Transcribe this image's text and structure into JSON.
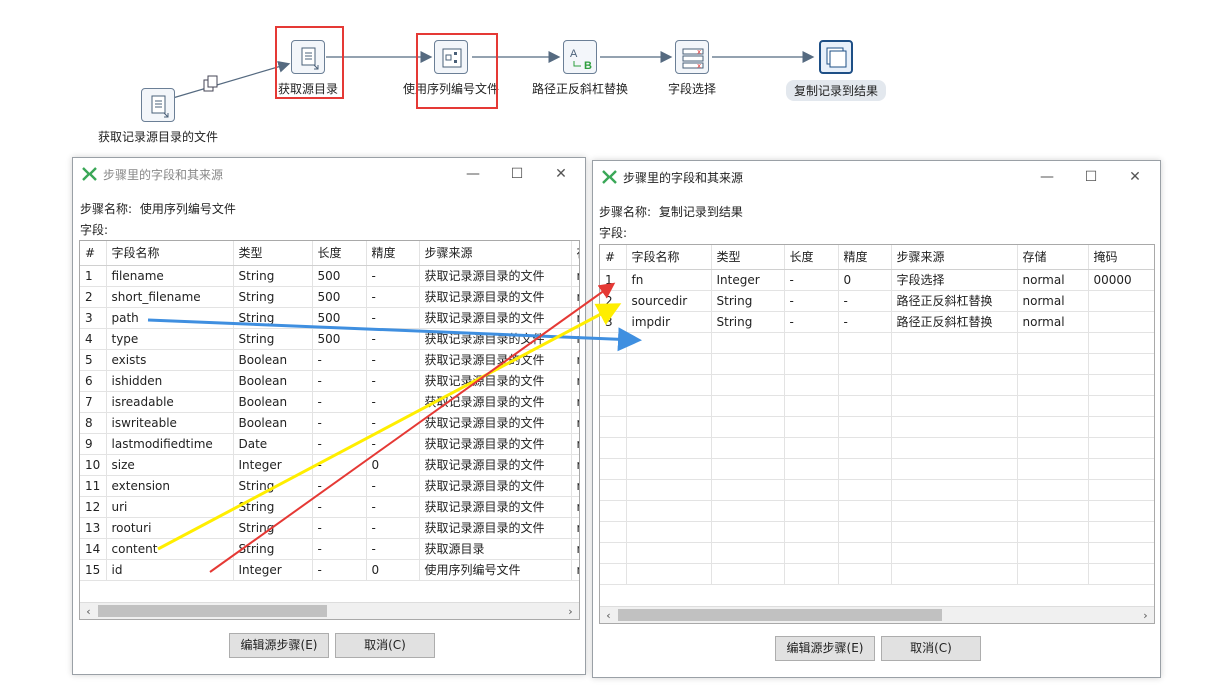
{
  "canvas": {
    "steps": [
      {
        "label": "获取记录源目录的文件"
      },
      {
        "label": "获取源目录"
      },
      {
        "label": "使用序列编号文件"
      },
      {
        "label": "路径正反斜杠替换"
      },
      {
        "label": "字段选择"
      },
      {
        "label": "复制记录到结果"
      }
    ]
  },
  "dialog_left": {
    "title": "步骤里的字段和其来源",
    "step_name_label": "步骤名称:",
    "step_name_value": "使用序列编号文件",
    "fields_label": "字段:",
    "columns": [
      "#",
      "字段名称",
      "类型",
      "长度",
      "精度",
      "步骤来源",
      "存"
    ],
    "rows": [
      [
        "1",
        "filename",
        "String",
        "500",
        "-",
        "获取记录源目录的文件",
        "n"
      ],
      [
        "2",
        "short_filename",
        "String",
        "500",
        "-",
        "获取记录源目录的文件",
        "n"
      ],
      [
        "3",
        "path",
        "String",
        "500",
        "-",
        "获取记录源目录的文件",
        "n"
      ],
      [
        "4",
        "type",
        "String",
        "500",
        "-",
        "获取记录源目录的文件",
        "n"
      ],
      [
        "5",
        "exists",
        "Boolean",
        "-",
        "-",
        "获取记录源目录的文件",
        "n"
      ],
      [
        "6",
        "ishidden",
        "Boolean",
        "-",
        "-",
        "获取记录源目录的文件",
        "n"
      ],
      [
        "7",
        "isreadable",
        "Boolean",
        "-",
        "-",
        "获取记录源目录的文件",
        "n"
      ],
      [
        "8",
        "iswriteable",
        "Boolean",
        "-",
        "-",
        "获取记录源目录的文件",
        "n"
      ],
      [
        "9",
        "lastmodifiedtime",
        "Date",
        "-",
        "-",
        "获取记录源目录的文件",
        "n"
      ],
      [
        "10",
        "size",
        "Integer",
        "-",
        "0",
        "获取记录源目录的文件",
        "n"
      ],
      [
        "11",
        "extension",
        "String",
        "-",
        "-",
        "获取记录源目录的文件",
        "n"
      ],
      [
        "12",
        "uri",
        "String",
        "-",
        "-",
        "获取记录源目录的文件",
        "n"
      ],
      [
        "13",
        "rooturi",
        "String",
        "-",
        "-",
        "获取记录源目录的文件",
        "n"
      ],
      [
        "14",
        "content",
        "String",
        "-",
        "-",
        "获取源目录",
        "n"
      ],
      [
        "15",
        "id",
        "Integer",
        "-",
        "0",
        "使用序列编号文件",
        "n"
      ]
    ],
    "edit_button": "编辑源步骤(E)",
    "cancel_button": "取消(C)"
  },
  "dialog_right": {
    "title": "步骤里的字段和其来源",
    "step_name_label": "步骤名称:",
    "step_name_value": "复制记录到结果",
    "fields_label": "字段:",
    "columns": [
      "#",
      "字段名称",
      "类型",
      "长度",
      "精度",
      "步骤来源",
      "存储",
      "掩码"
    ],
    "rows": [
      [
        "1",
        "fn",
        "Integer",
        "-",
        "0",
        "字段选择",
        "normal",
        "00000"
      ],
      [
        "2",
        "sourcedir",
        "String",
        "-",
        "-",
        "路径正反斜杠替换",
        "normal",
        ""
      ],
      [
        "3",
        "impdir",
        "String",
        "-",
        "-",
        "路径正反斜杠替换",
        "normal",
        ""
      ]
    ],
    "edit_button": "编辑源步骤(E)",
    "cancel_button": "取消(C)"
  },
  "colors": {
    "highlight_red": "#e53935",
    "arrow_red": "#e53935",
    "arrow_yellow": "#ffee00",
    "arrow_blue": "#3f8fe0",
    "hop_line": "#556a80"
  }
}
